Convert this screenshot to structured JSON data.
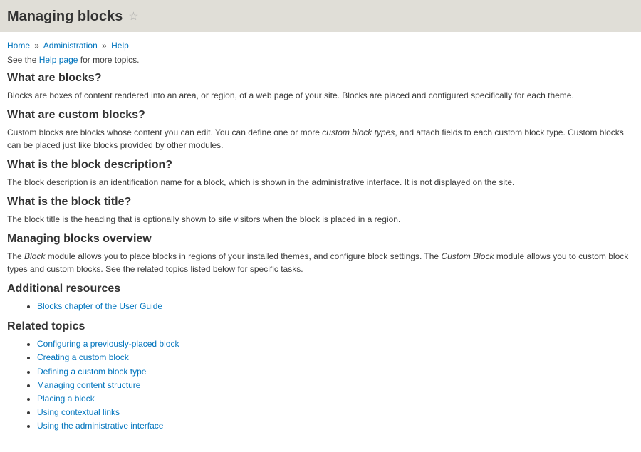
{
  "header": {
    "title": "Managing blocks"
  },
  "breadcrumb": {
    "items": [
      "Home",
      "Administration",
      "Help"
    ],
    "separator": "»"
  },
  "intro": {
    "prefix": "See the ",
    "link_text": "Help page",
    "suffix": " for more topics."
  },
  "sections": {
    "what_are_blocks": {
      "heading": "What are blocks?",
      "body": "Blocks are boxes of content rendered into an area, or region, of a web page of your site. Blocks are placed and configured specifically for each theme."
    },
    "what_are_custom_blocks": {
      "heading": "What are custom blocks?",
      "body_pre": "Custom blocks are blocks whose content you can edit. You can define one or more ",
      "body_em": "custom block types",
      "body_post": ", and attach fields to each custom block type. Custom blocks can be placed just like blocks provided by other modules."
    },
    "block_description": {
      "heading": "What is the block description?",
      "body": "The block description is an identification name for a block, which is shown in the administrative interface. It is not displayed on the site."
    },
    "block_title": {
      "heading": "What is the block title?",
      "body": "The block title is the heading that is optionally shown to site visitors when the block is placed in a region."
    },
    "overview": {
      "heading": "Managing blocks overview",
      "pre1": "The ",
      "em1": "Block",
      "mid1": " module allows you to place blocks in regions of your installed themes, and configure block settings. The ",
      "em2": "Custom Block",
      "post1": " module allows you to custom block types and custom blocks. See the related topics listed below for specific tasks."
    }
  },
  "resources": {
    "heading": "Additional resources",
    "items": [
      "Blocks chapter of the User Guide"
    ]
  },
  "related": {
    "heading": "Related topics",
    "items": [
      "Configuring a previously-placed block",
      "Creating a custom block",
      "Defining a custom block type",
      "Managing content structure",
      "Placing a block",
      "Using contextual links",
      "Using the administrative interface"
    ]
  }
}
